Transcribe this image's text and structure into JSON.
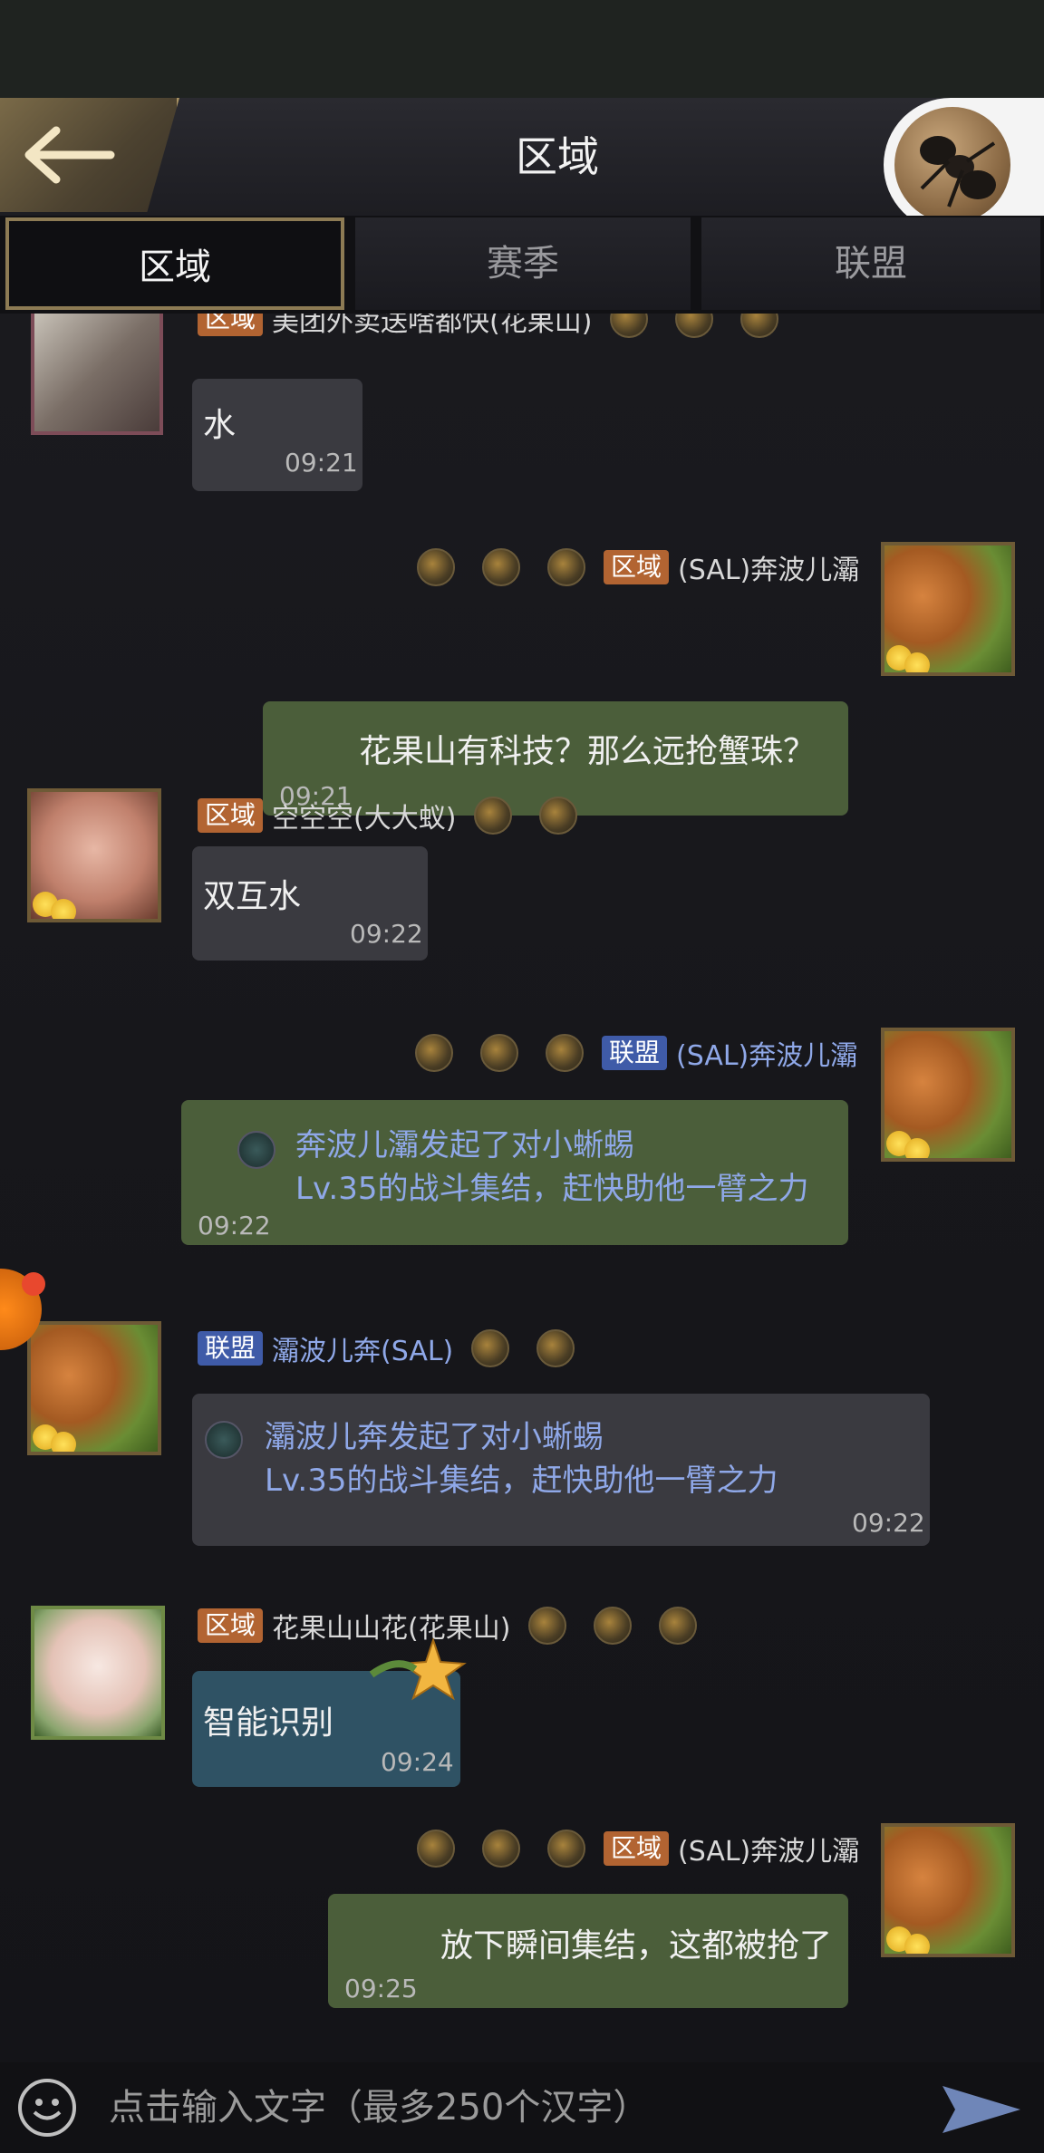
{
  "header": {
    "title": "区域",
    "back_label": ""
  },
  "tabs": [
    {
      "label": "区域",
      "active": true
    },
    {
      "label": "赛季",
      "active": false
    },
    {
      "label": "联盟",
      "active": false
    }
  ],
  "messages": [
    {
      "side": "left",
      "channel": "区域",
      "channel_type": "region",
      "sender": "美团外卖送啥都快(花果山)",
      "text": "水",
      "time": "09:21"
    },
    {
      "side": "right",
      "channel": "区域",
      "channel_type": "region",
      "sender": "(SAL)奔波儿灞",
      "text": "花果山有科技？那么远抢蟹珠？",
      "time": "09:21"
    },
    {
      "side": "left",
      "channel": "区域",
      "channel_type": "region",
      "sender": "空空空(大大蚁)",
      "text": "双互水",
      "time": "09:22"
    },
    {
      "side": "right",
      "channel": "联盟",
      "channel_type": "alliance",
      "sender": "(SAL)奔波儿灞",
      "line1": "奔波儿灞发起了对小蜥蜴",
      "line2": "Lv.35的战斗集结，赶快助他一臂之力",
      "time": "09:22"
    },
    {
      "side": "left",
      "channel": "联盟",
      "channel_type": "alliance",
      "sender": "灞波儿奔(SAL)",
      "line1": "灞波儿奔发起了对小蜥蜴",
      "line2": "Lv.35的战斗集结，赶快助他一臂之力",
      "time": "09:22"
    },
    {
      "side": "left",
      "channel": "区域",
      "channel_type": "region",
      "sender": "花果山山花(花果山)",
      "text": "智能识别",
      "time": "09:24"
    },
    {
      "side": "right",
      "channel": "区域",
      "channel_type": "region",
      "sender": "(SAL)奔波儿灞",
      "text": "放下瞬间集结，这都被抢了",
      "time": "09:25"
    }
  ],
  "input": {
    "placeholder": "点击输入文字（最多250个汉字）"
  },
  "colors": {
    "region_tag": "#b26432",
    "alliance_tag": "#3f5ba8",
    "bubble_green": "#4b5e3a",
    "bubble_dark": "#3a3a40",
    "link_text": "#8fa8e8"
  }
}
